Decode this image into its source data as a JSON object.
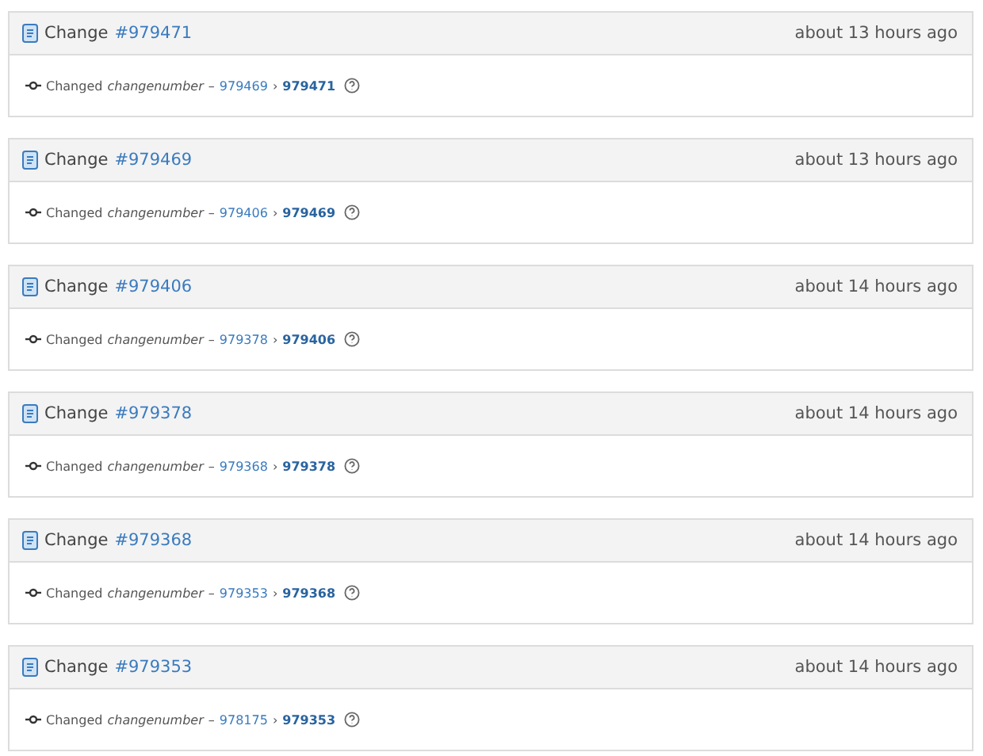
{
  "changes": [
    {
      "title": "Change",
      "number": "#979471",
      "time": "about 13 hours ago",
      "action": "Changed",
      "field": "changenumber",
      "dash": "–",
      "from": "979469",
      "arrow": "›",
      "to": "979471"
    },
    {
      "title": "Change",
      "number": "#979469",
      "time": "about 13 hours ago",
      "action": "Changed",
      "field": "changenumber",
      "dash": "–",
      "from": "979406",
      "arrow": "›",
      "to": "979469"
    },
    {
      "title": "Change",
      "number": "#979406",
      "time": "about 14 hours ago",
      "action": "Changed",
      "field": "changenumber",
      "dash": "–",
      "from": "979378",
      "arrow": "›",
      "to": "979406"
    },
    {
      "title": "Change",
      "number": "#979378",
      "time": "about 14 hours ago",
      "action": "Changed",
      "field": "changenumber",
      "dash": "–",
      "from": "979368",
      "arrow": "›",
      "to": "979378"
    },
    {
      "title": "Change",
      "number": "#979368",
      "time": "about 14 hours ago",
      "action": "Changed",
      "field": "changenumber",
      "dash": "–",
      "from": "979353",
      "arrow": "›",
      "to": "979368"
    },
    {
      "title": "Change",
      "number": "#979353",
      "time": "about 14 hours ago",
      "action": "Changed",
      "field": "changenumber",
      "dash": "–",
      "from": "978175",
      "arrow": "›",
      "to": "979353"
    }
  ]
}
